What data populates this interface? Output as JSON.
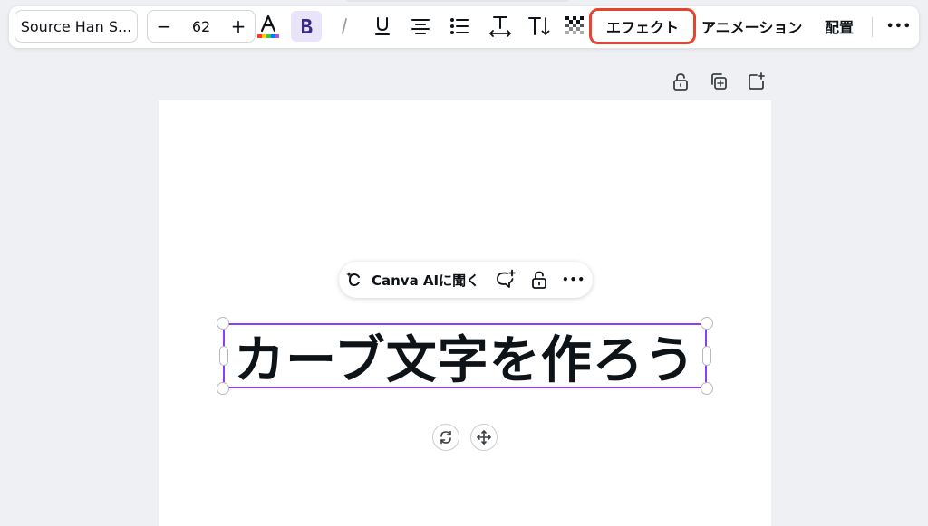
{
  "toolbar": {
    "font_name": "Source Han S...",
    "font_size": "62",
    "size_minus": "−",
    "size_plus": "+",
    "effects_label": "エフェクト",
    "animation_label": "アニメーション",
    "position_label": "配置",
    "more_label": "•••"
  },
  "float_toolbar": {
    "ai_label": "Canva AIに聞く",
    "more_label": "•••"
  },
  "canvas": {
    "text": "カーブ文字を作ろう"
  },
  "colors": {
    "accent": "#8b3dff",
    "highlight_red": "#e8442d",
    "bold_bg": "#eae4fb"
  }
}
